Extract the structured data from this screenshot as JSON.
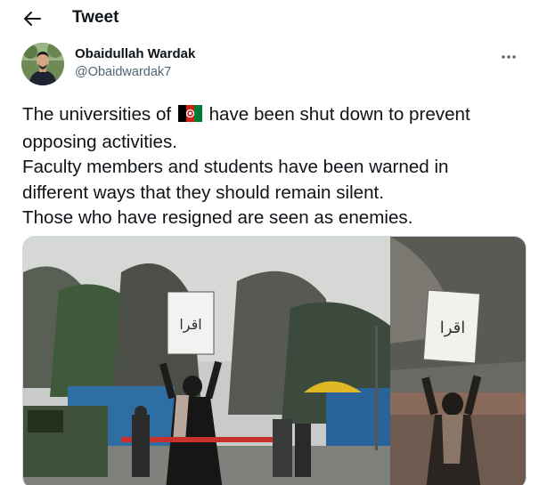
{
  "header": {
    "title": "Tweet",
    "back_icon": "arrow-left-icon"
  },
  "author": {
    "name": "Obaidullah Wardak",
    "handle": "@Obaidwardak7",
    "more_icon": "more-horizontal-icon"
  },
  "tweet": {
    "lines": {
      "line1_before": "The universities of",
      "line1_after": "have been shut down to prevent",
      "line2": "opposing activities.",
      "line3": "Faculty members and students have been warned in",
      "line4": "different ways that they should remain silent.",
      "line5": "Those who have resigned are seen as enemies."
    },
    "flag_icon": "afghanistan-flag-emoji"
  },
  "media": {
    "sign_text": "اقرا",
    "colors": {
      "text": "#0f1419",
      "secondary": "#536471",
      "border": "#cfd9de"
    }
  }
}
